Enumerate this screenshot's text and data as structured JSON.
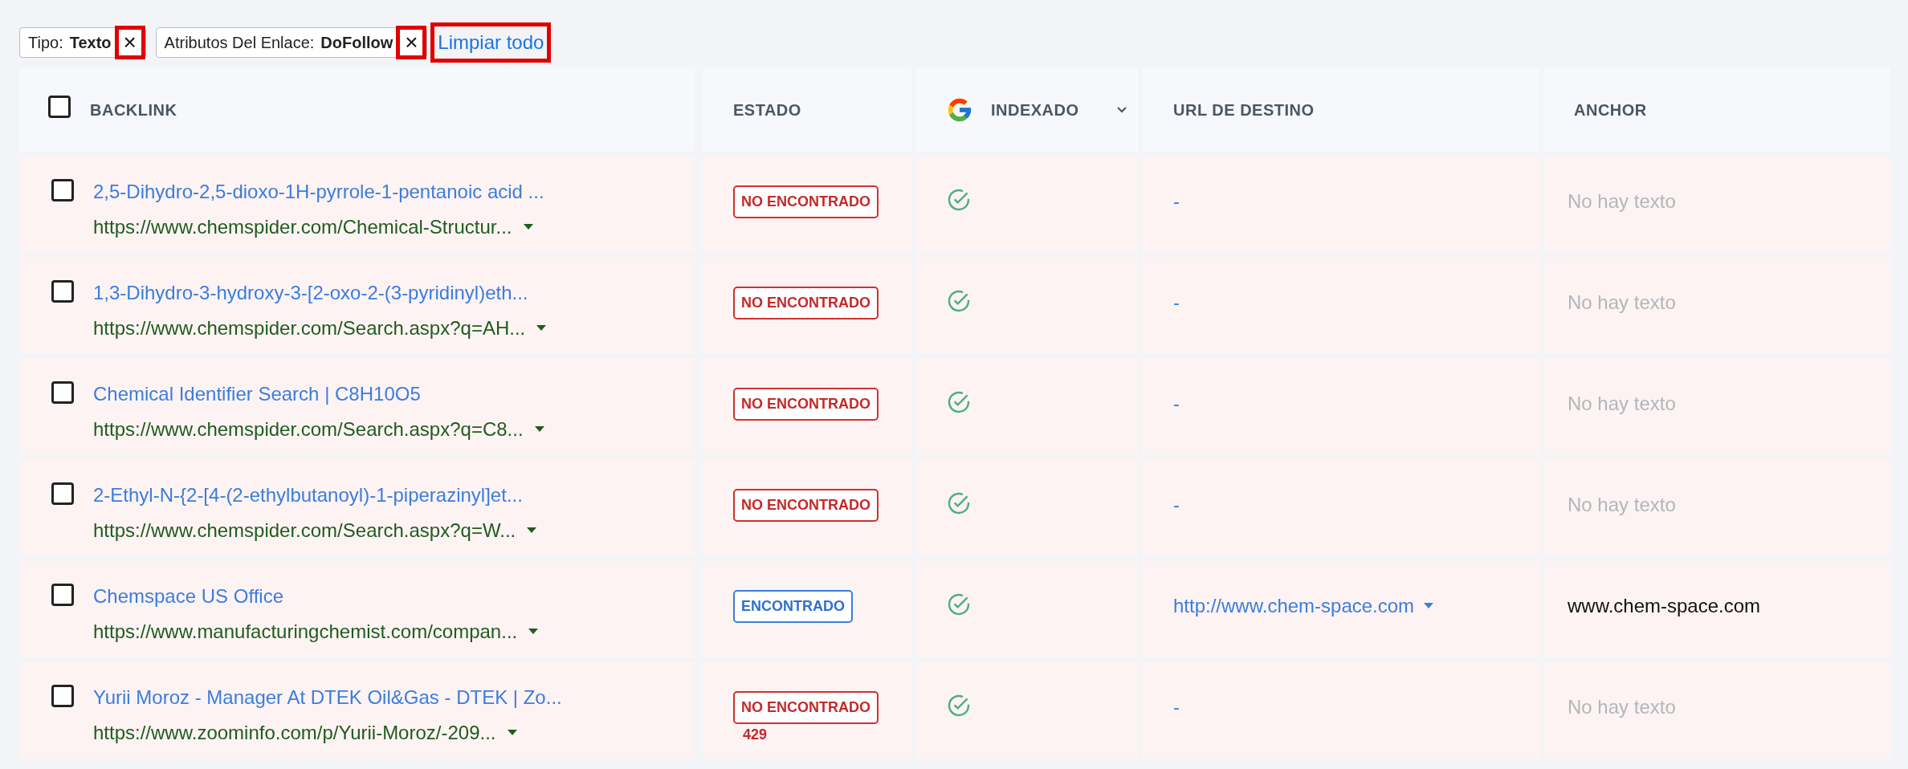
{
  "filters": [
    {
      "label": "Tipo:",
      "value": "Texto",
      "remove": "×"
    },
    {
      "label": "Atributos Del Enlace:",
      "value": "DoFollow",
      "remove": "×"
    }
  ],
  "clear_all": "Limpiar todo",
  "table": {
    "select_all": {
      "checked": false
    },
    "columns": [
      {
        "label": "BACKLINK",
        "kind": "plain"
      },
      {
        "label": "ESTADO",
        "kind": "plain"
      },
      {
        "label": "INDEXADO",
        "kind": "google"
      },
      {
        "label": "URL DE DESTINO",
        "kind": "plain"
      },
      {
        "label": "ANCHOR",
        "kind": "plain"
      }
    ],
    "rows": [
      {
        "checked": false,
        "title": "2,5-Dihydro-2,5-dioxo-1H-pyrrole-1-pentanoic acid ...",
        "url": "https://www.chemspider.com/Chemical-Structur...",
        "status": {
          "text": "NO ENCONTRADO",
          "kind": "not_found"
        },
        "indexed": true,
        "target": {
          "text": "-",
          "kind": "none"
        },
        "anchor": {
          "text": "No hay texto",
          "kind": "empty"
        }
      },
      {
        "checked": false,
        "title": "1,3-Dihydro-3-hydroxy-3-[2-oxo-2-(3-pyridinyl)eth...",
        "url": "https://www.chemspider.com/Search.aspx?q=AH...",
        "status": {
          "text": "NO ENCONTRADO",
          "kind": "not_found"
        },
        "indexed": true,
        "target": {
          "text": "-",
          "kind": "none"
        },
        "anchor": {
          "text": "No hay texto",
          "kind": "empty"
        }
      },
      {
        "checked": false,
        "title": "Chemical Identifier Search | C8H10O5",
        "url": "https://www.chemspider.com/Search.aspx?q=C8...",
        "status": {
          "text": "NO ENCONTRADO",
          "kind": "not_found"
        },
        "indexed": true,
        "target": {
          "text": "-",
          "kind": "none"
        },
        "anchor": {
          "text": "No hay texto",
          "kind": "empty"
        }
      },
      {
        "checked": false,
        "title": "2-Ethyl-N-{2-[4-(2-ethylbutanoyl)-1-piperazinyl]et...",
        "url": "https://www.chemspider.com/Search.aspx?q=W...",
        "status": {
          "text": "NO ENCONTRADO",
          "kind": "not_found"
        },
        "indexed": true,
        "target": {
          "text": "-",
          "kind": "none"
        },
        "anchor": {
          "text": "No hay texto",
          "kind": "empty"
        }
      },
      {
        "checked": false,
        "title": "Chemspace US Office",
        "url": "https://www.manufacturingchemist.com/compan...",
        "status": {
          "text": "ENCONTRADO",
          "kind": "found"
        },
        "indexed": true,
        "target": {
          "text": "http://www.chem-space.com",
          "kind": "link"
        },
        "anchor": {
          "text": "www.chem-space.com",
          "kind": "text"
        }
      },
      {
        "checked": false,
        "title": "Yurii Moroz - Manager At DTEK Oil&Gas - DTEK | Zo...",
        "url": "https://www.zoominfo.com/p/Yurii-Moroz/-209...",
        "status": {
          "text": "NO ENCONTRADO",
          "kind": "not_found",
          "code": "429"
        },
        "indexed": true,
        "target": {
          "text": "-",
          "kind": "none"
        },
        "anchor": {
          "text": "No hay texto",
          "kind": "empty"
        }
      }
    ]
  }
}
